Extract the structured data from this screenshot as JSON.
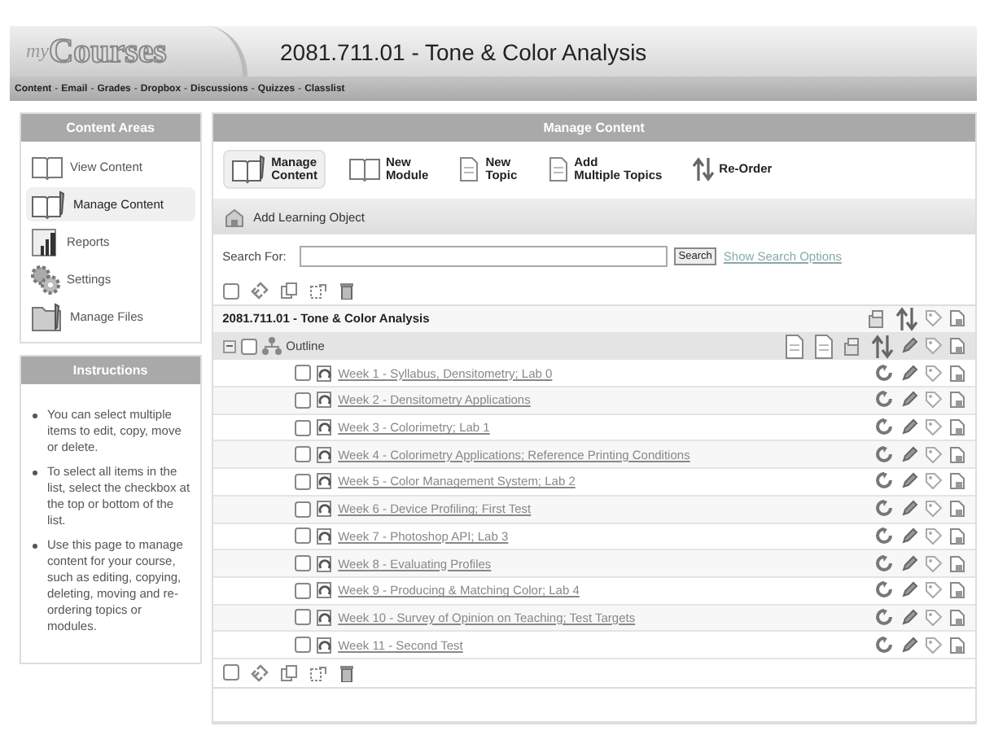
{
  "header": {
    "logo_prefix": "my",
    "logo": "Courses",
    "course_title": "2081.711.01 - Tone & Color Analysis",
    "separator": "-",
    "nav": [
      "Content",
      "Email",
      "Grades",
      "Dropbox",
      "Discussions",
      "Quizzes",
      "Classlist"
    ]
  },
  "sidebar": {
    "title": "Content Areas",
    "items": [
      {
        "label": "View Content",
        "selected": false
      },
      {
        "label": "Manage Content",
        "selected": true
      },
      {
        "label": "Reports",
        "selected": false
      },
      {
        "label": "Settings",
        "selected": false
      },
      {
        "label": "Manage Files",
        "selected": false
      }
    ]
  },
  "instructions": {
    "title": "Instructions",
    "items": [
      "You can select multiple items to edit, copy, move or delete.",
      "To select all items in the list, select the checkbox at the top or bottom of the list.",
      "Use this page to manage content for your course, such as editing, copying, deleting, moving and re-ordering topics or modules."
    ]
  },
  "main": {
    "title": "Manage Content",
    "toolbar": [
      {
        "lines": [
          "Manage",
          "Content"
        ],
        "selected": true
      },
      {
        "lines": [
          "New",
          "Module"
        ],
        "selected": false
      },
      {
        "lines": [
          "New",
          "Topic"
        ],
        "selected": false
      },
      {
        "lines": [
          "Add",
          "Multiple Topics"
        ],
        "selected": false
      },
      {
        "lines": [
          "Re-Order"
        ],
        "selected": false
      }
    ],
    "add_button": "Add Learning Object",
    "search": {
      "label": "Search For:",
      "button": "Search",
      "link": "Show Search Options"
    },
    "select_all_top": {
      "checked": false
    },
    "select_all_bottom": {
      "checked": false
    },
    "course_row": "2081.711.01 - Tone & Color Analysis",
    "outline": {
      "label": "Outline",
      "checked": false,
      "expanded": true
    },
    "topics": [
      {
        "title": "Week 1 - Syllabus, Densitometry; Lab 0",
        "checked": false
      },
      {
        "title": "Week 2 - Densitometry Applications",
        "checked": false
      },
      {
        "title": "Week 3 - Colorimetry; Lab 1",
        "checked": false
      },
      {
        "title": "Week 4 - Colorimetry Applications; Reference Printing Conditions",
        "checked": false
      },
      {
        "title": "Week 5 - Color Management System; Lab 2",
        "checked": false
      },
      {
        "title": "Week 6 - Device Profiling; First Test",
        "checked": false
      },
      {
        "title": "Week 7 - Photoshop API; Lab 3",
        "checked": false
      },
      {
        "title": "Week 8 - Evaluating Profiles",
        "checked": false
      },
      {
        "title": "Week 9 - Producing & Matching Color; Lab 4",
        "checked": false
      },
      {
        "title": "Week 10 - Survey of Opinion on Teaching; Test Targets",
        "checked": false
      },
      {
        "title": "Week 11 - Second Test",
        "checked": false
      }
    ]
  }
}
